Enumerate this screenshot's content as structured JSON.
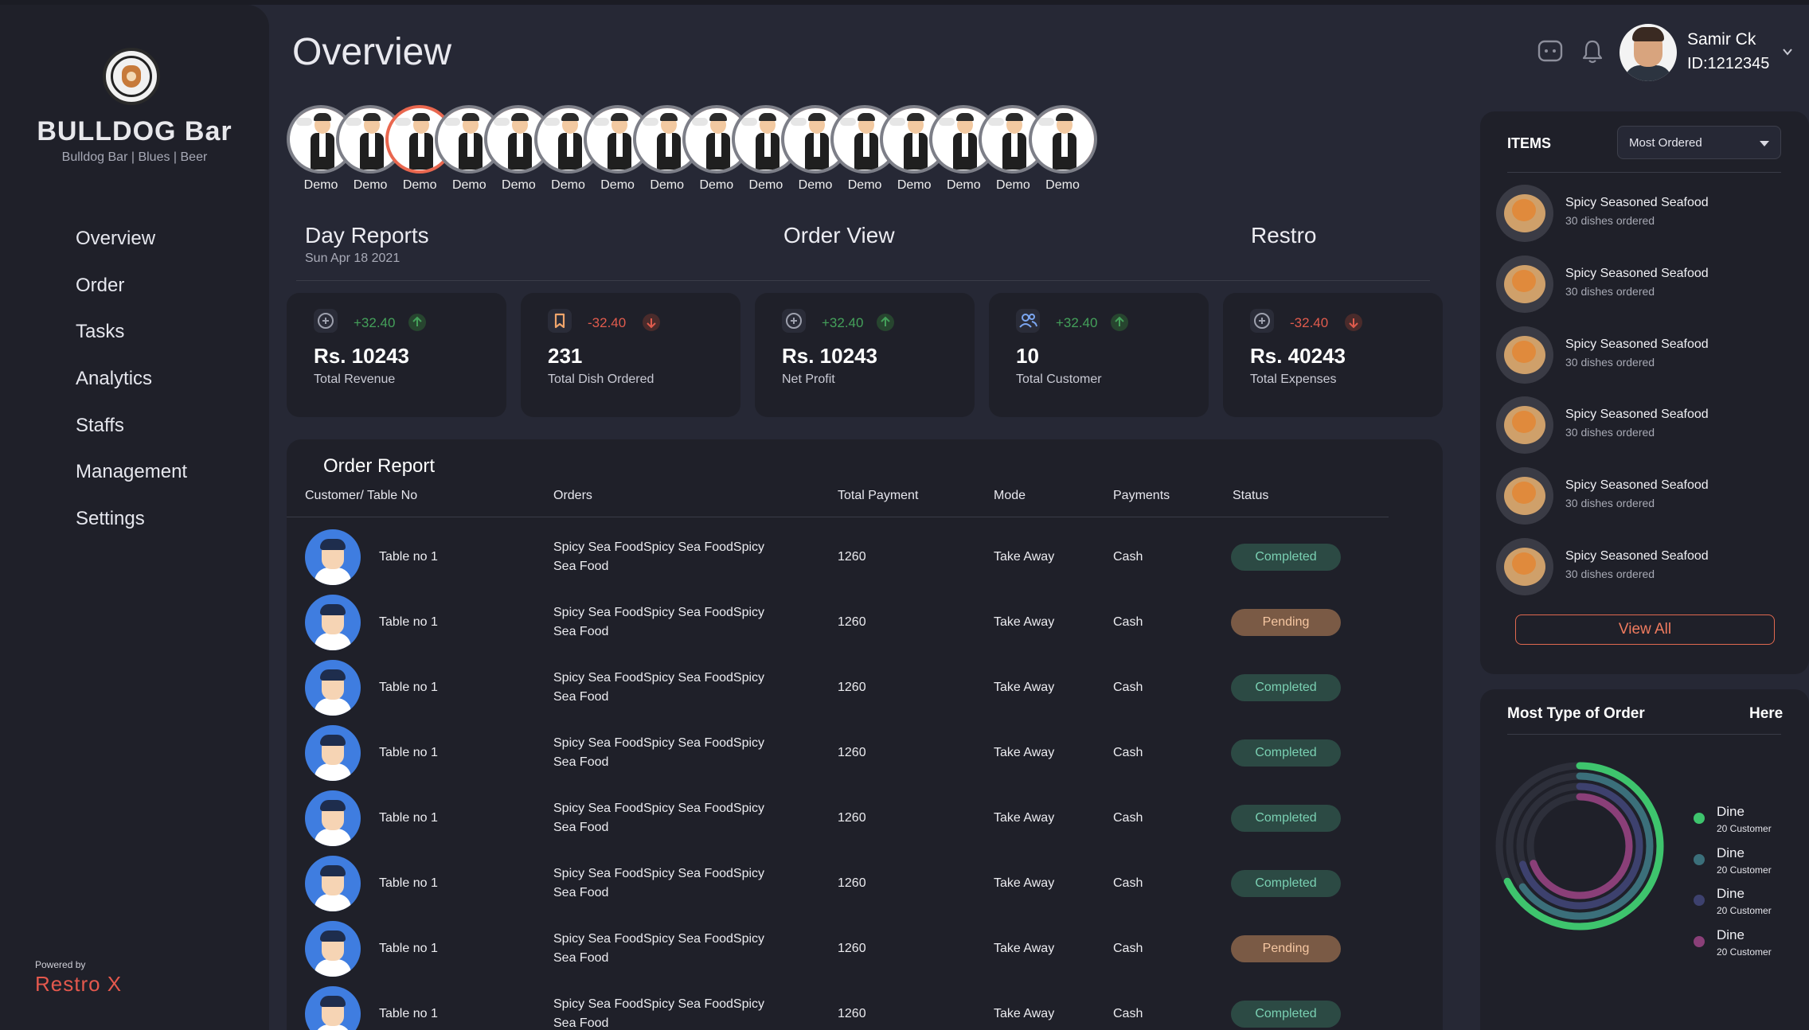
{
  "brand": {
    "title": "BULLDOG Bar",
    "subtitle": "Bulldog Bar | Blues | Beer"
  },
  "nav": [
    "Overview",
    "Order",
    "Tasks",
    "Analytics",
    "Staffs",
    "Management",
    "Settings"
  ],
  "footer": {
    "powered_by": "Powered by",
    "product": "Restro X"
  },
  "header": {
    "title": "Overview",
    "user_name": "Samir Ck",
    "user_id": "ID:1212345",
    "icons": [
      "chat-icon",
      "bell-icon",
      "chevron-down-icon"
    ]
  },
  "stories": [
    "Demo",
    "Demo",
    "Demo",
    "Demo",
    "Demo",
    "Demo",
    "Demo",
    "Demo",
    "Demo",
    "Demo",
    "Demo",
    "Demo",
    "Demo",
    "Demo",
    "Demo",
    "Demo"
  ],
  "sections": {
    "day_reports": "Day Reports",
    "date": "Sun Apr 18 2021",
    "order_view": "Order View",
    "restro": "Restro"
  },
  "stats": [
    {
      "icon": "coin-icon",
      "delta": "+32.40",
      "trend": "up",
      "value": "Rs. 10243",
      "label": "Total Revenue"
    },
    {
      "icon": "bookmark-icon",
      "delta": "-32.40",
      "trend": "down",
      "value": "231",
      "label": "Total Dish Ordered"
    },
    {
      "icon": "coin-icon",
      "delta": "+32.40",
      "trend": "up",
      "value": "Rs. 10243",
      "label": "Net Profit"
    },
    {
      "icon": "users-icon",
      "delta": "+32.40",
      "trend": "up",
      "value": "10",
      "label": "Total Customer"
    },
    {
      "icon": "coin-icon",
      "delta": "-32.40",
      "trend": "down",
      "value": "Rs. 40243",
      "label": "Total Expenses"
    }
  ],
  "colors": {
    "up": "#44a05a",
    "down": "#e05b4d",
    "accent": "#e9674f",
    "completed_bg": "#2c4a44",
    "pending_bg": "#7a5a45"
  },
  "report": {
    "title": "Order Report",
    "columns": [
      "Customer/ Table No",
      "Orders",
      "Total Payment",
      "Mode",
      "Payments",
      "Status"
    ],
    "rows": [
      {
        "customer": "Table no 1",
        "order_l1": "Spicy Sea FoodSpicy Sea FoodSpicy",
        "order_l2": "Sea Food",
        "payment": "1260",
        "mode": "Take Away",
        "pay": "Cash",
        "status": "Completed"
      },
      {
        "customer": "Table no 1",
        "order_l1": "Spicy Sea FoodSpicy Sea FoodSpicy",
        "order_l2": "Sea Food",
        "payment": "1260",
        "mode": "Take Away",
        "pay": "Cash",
        "status": "Pending"
      },
      {
        "customer": "Table no 1",
        "order_l1": "Spicy Sea FoodSpicy Sea FoodSpicy",
        "order_l2": "Sea Food",
        "payment": "1260",
        "mode": "Take Away",
        "pay": "Cash",
        "status": "Completed"
      },
      {
        "customer": "Table no 1",
        "order_l1": "Spicy Sea FoodSpicy Sea FoodSpicy",
        "order_l2": "Sea Food",
        "payment": "1260",
        "mode": "Take Away",
        "pay": "Cash",
        "status": "Completed"
      },
      {
        "customer": "Table no 1",
        "order_l1": "Spicy Sea FoodSpicy Sea FoodSpicy",
        "order_l2": "Sea Food",
        "payment": "1260",
        "mode": "Take Away",
        "pay": "Cash",
        "status": "Completed"
      },
      {
        "customer": "Table no 1",
        "order_l1": "Spicy Sea FoodSpicy Sea FoodSpicy",
        "order_l2": "Sea Food",
        "payment": "1260",
        "mode": "Take Away",
        "pay": "Cash",
        "status": "Completed"
      },
      {
        "customer": "Table no 1",
        "order_l1": "Spicy Sea FoodSpicy Sea FoodSpicy",
        "order_l2": "Sea Food",
        "payment": "1260",
        "mode": "Take Away",
        "pay": "Cash",
        "status": "Pending"
      },
      {
        "customer": "Table no 1",
        "order_l1": "Spicy Sea FoodSpicy Sea FoodSpicy",
        "order_l2": "Sea Food",
        "payment": "1260",
        "mode": "Take Away",
        "pay": "Cash",
        "status": "Completed"
      }
    ]
  },
  "items": {
    "title": "ITEMS",
    "filter": "Most Ordered",
    "list": [
      {
        "name": "Spicy Seasoned Seafood",
        "sub": "30 dishes ordered"
      },
      {
        "name": "Spicy Seasoned Seafood",
        "sub": "30 dishes ordered"
      },
      {
        "name": "Spicy Seasoned Seafood",
        "sub": "30 dishes ordered"
      },
      {
        "name": "Spicy Seasoned Seafood",
        "sub": "30 dishes ordered"
      },
      {
        "name": "Spicy Seasoned Seafood",
        "sub": "30 dishes ordered"
      },
      {
        "name": "Spicy Seasoned Seafood",
        "sub": "30 dishes ordered"
      }
    ],
    "view_all": "View All"
  },
  "order_types": {
    "title": "Most Type of Order",
    "link": "Here",
    "legend": [
      {
        "label": "Dine",
        "sub": "20 Customer",
        "color": "#3ec46d"
      },
      {
        "label": "Dine",
        "sub": "20 Customer",
        "color": "#3b6f7a"
      },
      {
        "label": "Dine",
        "sub": "20 Customer",
        "color": "#3d416e"
      },
      {
        "label": "Dine",
        "sub": "20 Customer",
        "color": "#8a3f78"
      }
    ]
  }
}
